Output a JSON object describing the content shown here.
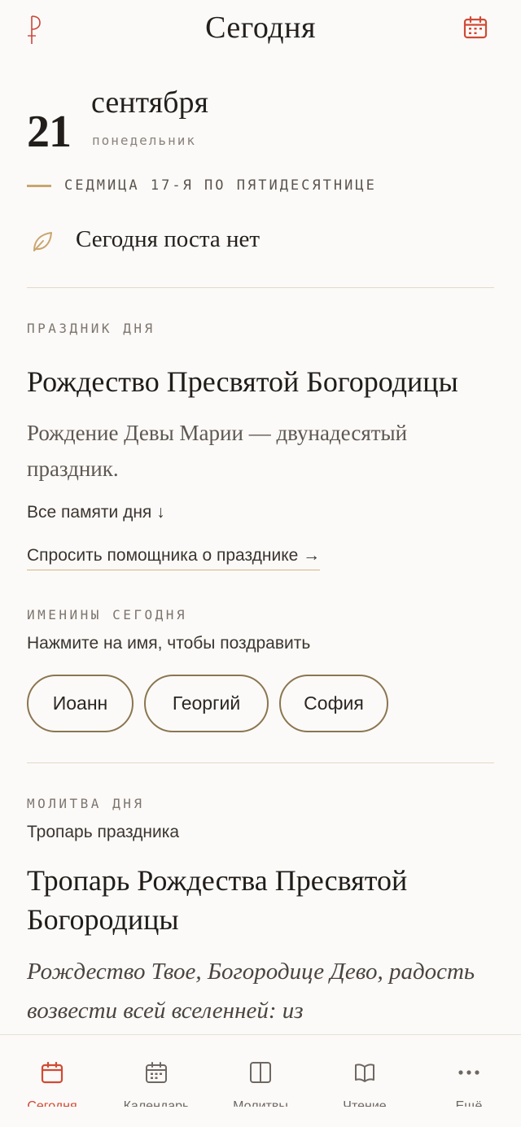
{
  "header": {
    "logo_letter": "Р",
    "title": "Сегодня",
    "calendar_icon": "calendar-icon"
  },
  "date": {
    "day": "21",
    "month": "сентября",
    "weekday": "понедельник",
    "week": "СЕДМИЦА 17-Я ПО ПЯТИДЕСЯТНИЦЕ"
  },
  "fast": {
    "icon": "leaf-icon",
    "text": "Сегодня поста нет"
  },
  "feast": {
    "label": "ПРАЗДНИК ДНЯ",
    "title": "Рождество Пресвятой Богородицы",
    "description": "Рождение Девы Марии — двунадесятый праздник.",
    "all_memories": "Все памяти дня ↓",
    "ask_assistant": "Спросить помощника о празднике →"
  },
  "namedays": {
    "label": "ИМЕНИНЫ СЕГОДНЯ",
    "hint": "Нажмите на имя, чтобы поздравить",
    "names": [
      "Иоанн",
      "Георгий",
      "София"
    ]
  },
  "prayer": {
    "label": "МОЛИТВА ДНЯ",
    "subtitle": "Тропарь праздника",
    "title": "Тропарь Рождества Пресвятой Богородицы",
    "text": "Рождество Твое, Богородице Дево, радость возвести всей вселенней: из"
  },
  "nav": {
    "items": [
      {
        "label": "Сегодня",
        "icon": "calendar-icon"
      },
      {
        "label": "Календарь",
        "icon": "calendar-grid-icon"
      },
      {
        "label": "Молитвы",
        "icon": "book-split-icon"
      },
      {
        "label": "Чтение",
        "icon": "open-book-icon"
      },
      {
        "label": "Ещё",
        "icon": "more-dots-icon"
      }
    ]
  },
  "colors": {
    "accent": "#d04a35",
    "gold": "#c8a670",
    "chip_border": "#8a7650",
    "background": "#fcfaf8"
  }
}
